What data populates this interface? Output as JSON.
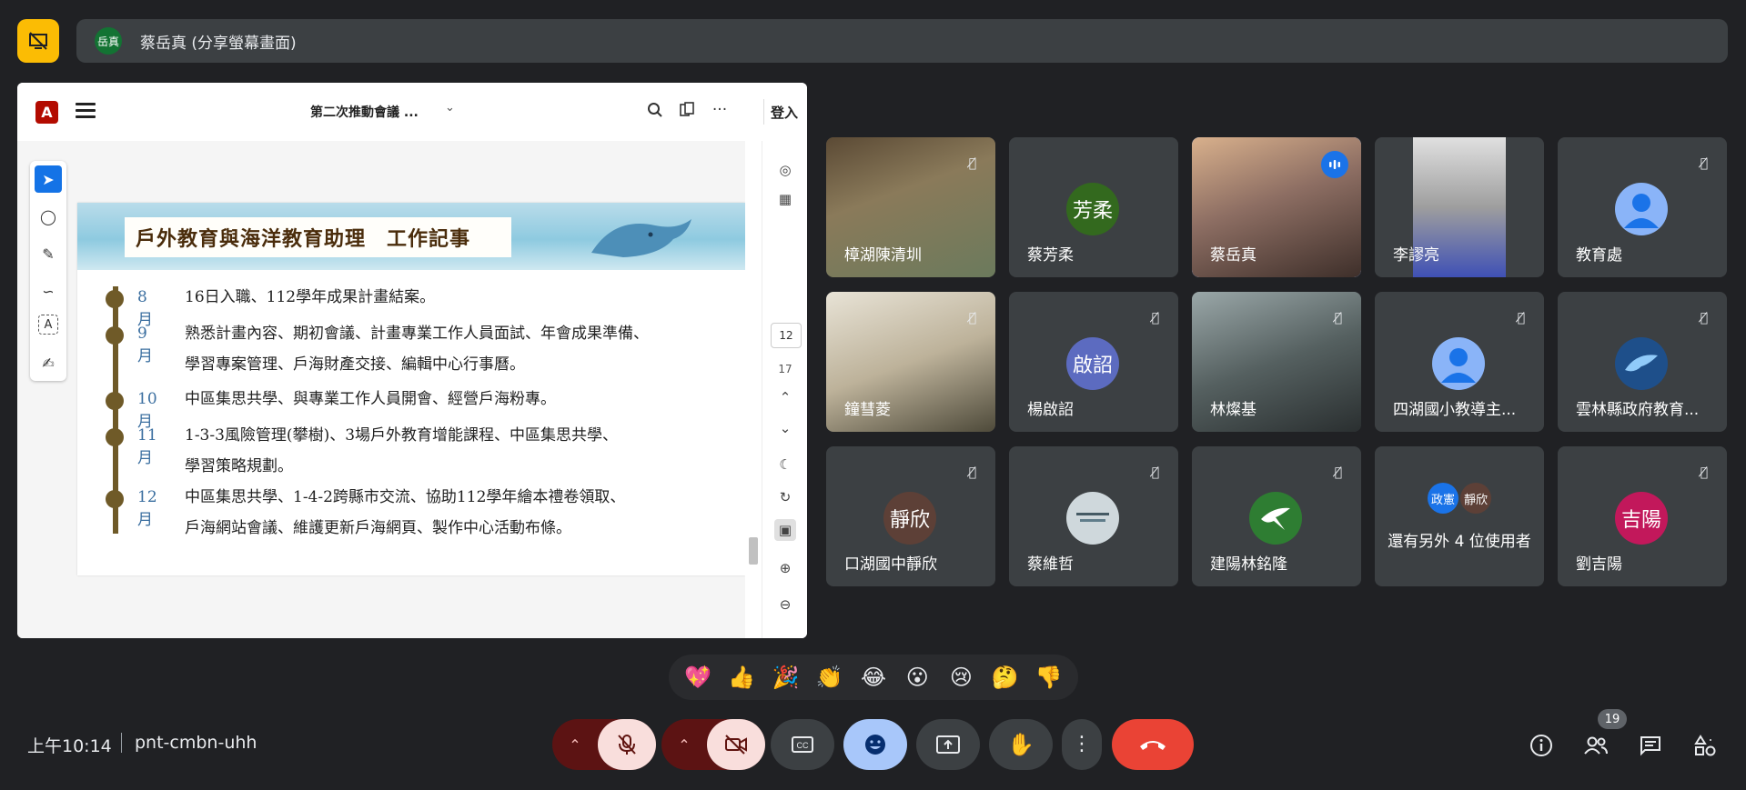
{
  "presenter": {
    "avatar_text": "岳真",
    "share_label": "蔡岳真 (分享螢幕畫面)"
  },
  "pdf": {
    "doc_title": "第二次推動會議 ...",
    "login_label": "登入",
    "page_current": "12",
    "page_total": "17",
    "page_title": "戶外教育與海洋教育助理　工作記事",
    "timeline": [
      {
        "month": "8月",
        "lines": [
          "16日入職、112學年成果計畫結案。"
        ]
      },
      {
        "month": "9月",
        "lines": [
          "熟悉計畫內容、期初會議、計畫專業工作人員面試、年會成果準備、",
          "學習專案管理、戶海財產交接、編輯中心行事曆。"
        ]
      },
      {
        "month": "10月",
        "lines": [
          "中區集思共學、與專業工作人員開會、經營戶海粉專。"
        ]
      },
      {
        "month": "11月",
        "lines": [
          "1-3-3風險管理(攀樹)、3場戶外教育增能課程、中區集思共學、",
          "學習策略規劃。"
        ]
      },
      {
        "month": "12月",
        "lines": [
          "中區集思共學、1-4-2跨縣市交流、協助112學年繪本禮卷領取、",
          "戶海網站會議、維護更新戶海網頁、製作中心活動布條。"
        ]
      }
    ]
  },
  "participants": [
    {
      "name": "樟湖陳清圳",
      "type": "video",
      "muted": true
    },
    {
      "name": "蔡芳柔",
      "type": "avatar",
      "avatar": "芳柔",
      "color": "#33691e",
      "muted": false
    },
    {
      "name": "蔡岳真",
      "type": "video",
      "muted": false,
      "speaking": true
    },
    {
      "name": "李謬亮",
      "type": "video",
      "muted": false
    },
    {
      "name": "教育處",
      "type": "person",
      "color": "#8ab4f8",
      "muted": true
    },
    {
      "name": "鐘彗菱",
      "type": "video",
      "muted": true
    },
    {
      "name": "楊啟詔",
      "type": "avatar",
      "avatar": "啟詔",
      "color": "#5c6bc0",
      "muted": true
    },
    {
      "name": "林燦基",
      "type": "video",
      "muted": true
    },
    {
      "name": "四湖國小教導主...",
      "type": "person",
      "color": "#8ab4f8",
      "muted": true
    },
    {
      "name": "雲林縣政府教育...",
      "type": "image",
      "color": "#1e4f8a",
      "muted": true
    },
    {
      "name": "口湖國中靜欣",
      "type": "avatar",
      "avatar": "靜欣",
      "color": "#5d4037",
      "muted": true
    },
    {
      "name": "蔡維哲",
      "type": "image",
      "color": "#cfd8dc",
      "muted": true
    },
    {
      "name": "建陽林銘隆",
      "type": "image",
      "color": "#2e7d32",
      "muted": true
    },
    {
      "name": "還有另外 4 位使用者",
      "type": "more",
      "avatars": [
        "政憲",
        "靜欣"
      ]
    },
    {
      "name": "劉吉陽",
      "type": "avatar",
      "avatar": "吉陽",
      "color": "#c2185b",
      "muted": true
    }
  ],
  "reactions": [
    "💖",
    "👍",
    "🎉",
    "👏",
    "😂",
    "😮",
    "😢",
    "🤔",
    "👎"
  ],
  "footer": {
    "time": "上午10:14",
    "meeting_code": "pnt-cmbn-uhh",
    "participant_count": "19"
  },
  "colors": {
    "background": "#202124",
    "tile": "#3c4043",
    "end_call": "#ea4335",
    "reaction_active": "#a8c7fa",
    "muted_control": "#f9dedc"
  }
}
